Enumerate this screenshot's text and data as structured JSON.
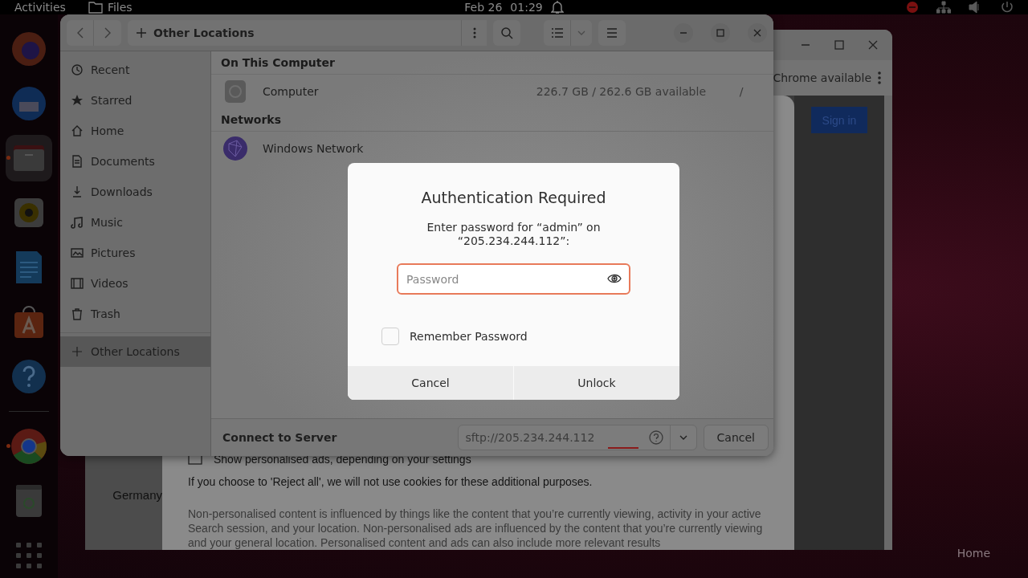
{
  "top_bar": {
    "activities": "Activities",
    "app_name": "Files",
    "date": "Feb 26",
    "time": "01:29"
  },
  "dock": [
    {
      "running": false,
      "selected": false
    },
    {
      "running": false,
      "selected": false
    },
    {
      "running": true,
      "selected": true
    },
    {
      "running": false,
      "selected": false
    },
    {
      "running": false,
      "selected": false
    },
    {
      "running": false,
      "selected": false
    },
    {
      "running": false,
      "selected": false
    },
    {
      "running": true,
      "selected": false
    },
    {
      "running": false,
      "selected": false
    }
  ],
  "browser_window": {
    "banner_text": "Chrome available",
    "sign_in": "Sign in",
    "region": "Germany",
    "consent_lines": [
      "Show personalised ads, depending on your settings",
      "If you choose to 'Reject all', we will not use cookies for these additional purposes.",
      "Non-personalised content is influenced by things like the content that you’re currently viewing, activity in your active Search session, and your location. Non-personalised ads are influenced by the content that you’re currently viewing and your general location. Personalised content and ads can also include more relevant results"
    ]
  },
  "files_window": {
    "location": "Other Locations",
    "sidebar": [
      {
        "label": "Recent",
        "selected": false
      },
      {
        "label": "Starred",
        "selected": false
      },
      {
        "label": "Home",
        "selected": false
      },
      {
        "label": "Documents",
        "selected": false
      },
      {
        "label": "Downloads",
        "selected": false
      },
      {
        "label": "Music",
        "selected": false
      },
      {
        "label": "Pictures",
        "selected": false
      },
      {
        "label": "Videos",
        "selected": false
      },
      {
        "label": "Trash",
        "selected": false
      }
    ],
    "other_locations": {
      "label": "Other Locations",
      "selected": true
    },
    "sections": [
      {
        "title": "On This Computer",
        "rows": [
          {
            "kind": "drive",
            "name": "Computer",
            "space": "226.7 GB / 262.6 GB available",
            "mount": "/"
          }
        ]
      },
      {
        "title": "Networks",
        "rows": [
          {
            "kind": "network",
            "name": "Windows Network"
          }
        ]
      }
    ],
    "connect_bar": {
      "label": "Connect to Server",
      "address": "sftp://205.234.244.112",
      "cancel": "Cancel"
    }
  },
  "dialog": {
    "title": "Authentication Required",
    "message": "Enter password for “admin” on\n“205.234.244.112”:",
    "password_placeholder": "Password",
    "remember": {
      "label": "Remember Password",
      "checked": false
    },
    "buttons": [
      "Cancel",
      "Unlock"
    ]
  },
  "desktop_icons": [
    {
      "label": "Home"
    }
  ]
}
